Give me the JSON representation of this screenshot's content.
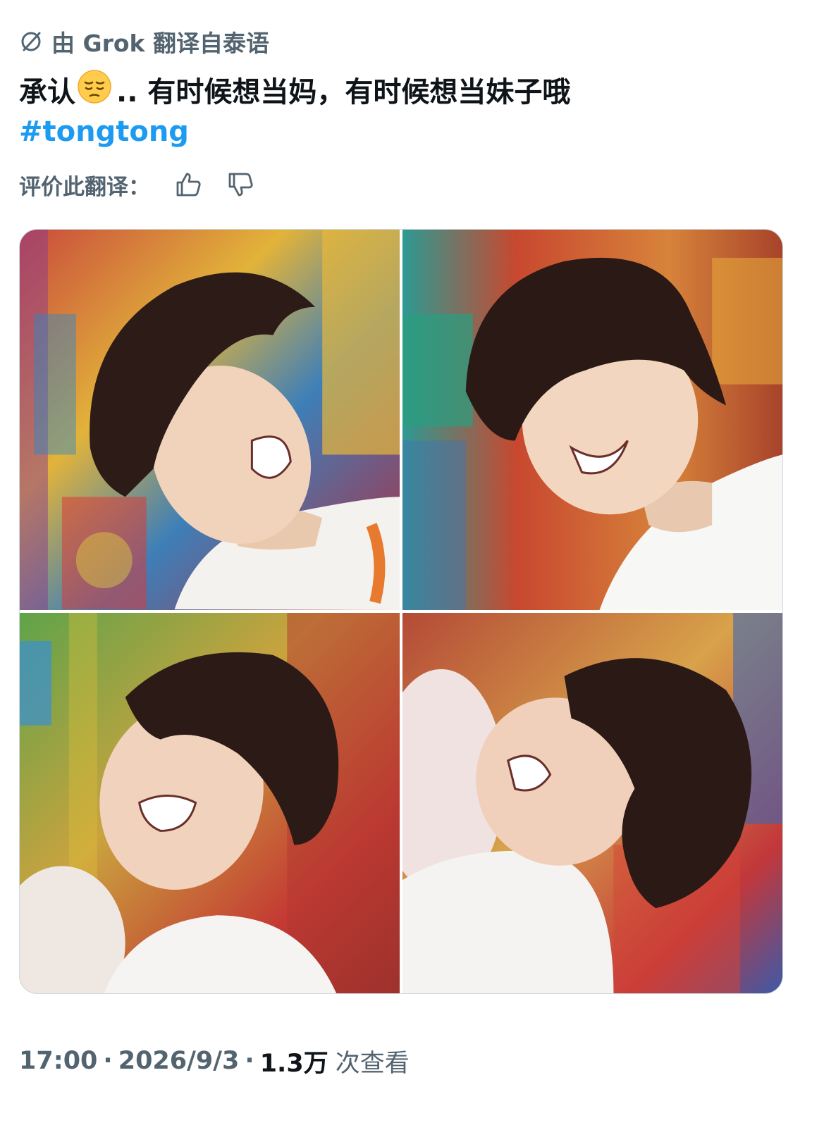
{
  "translation": {
    "icon": "no-entry-icon",
    "label": "由 Grok 翻译自泰语"
  },
  "post": {
    "text_before_emoji": "承认",
    "emoji": "pensive-face-emoji",
    "text_after_emoji": ".. 有时候想当妈，有时候想当妹子哦",
    "hashtag": "#tongtong"
  },
  "rating": {
    "label": "评价此翻译：",
    "like_icon": "thumbs-up-icon",
    "dislike_icon": "thumbs-down-icon"
  },
  "media": {
    "photo_count": 4,
    "photos": [
      {
        "name": "photo-top-left"
      },
      {
        "name": "photo-top-right"
      },
      {
        "name": "photo-bottom-left"
      },
      {
        "name": "photo-bottom-right"
      }
    ]
  },
  "footer": {
    "time": "17:00",
    "separator": "·",
    "date": "2026/9/3",
    "views": "1.3万",
    "views_label": "次查看"
  },
  "colors": {
    "accent": "#1d9bf0",
    "secondary_text": "#536471",
    "primary_text": "#0f1419"
  }
}
